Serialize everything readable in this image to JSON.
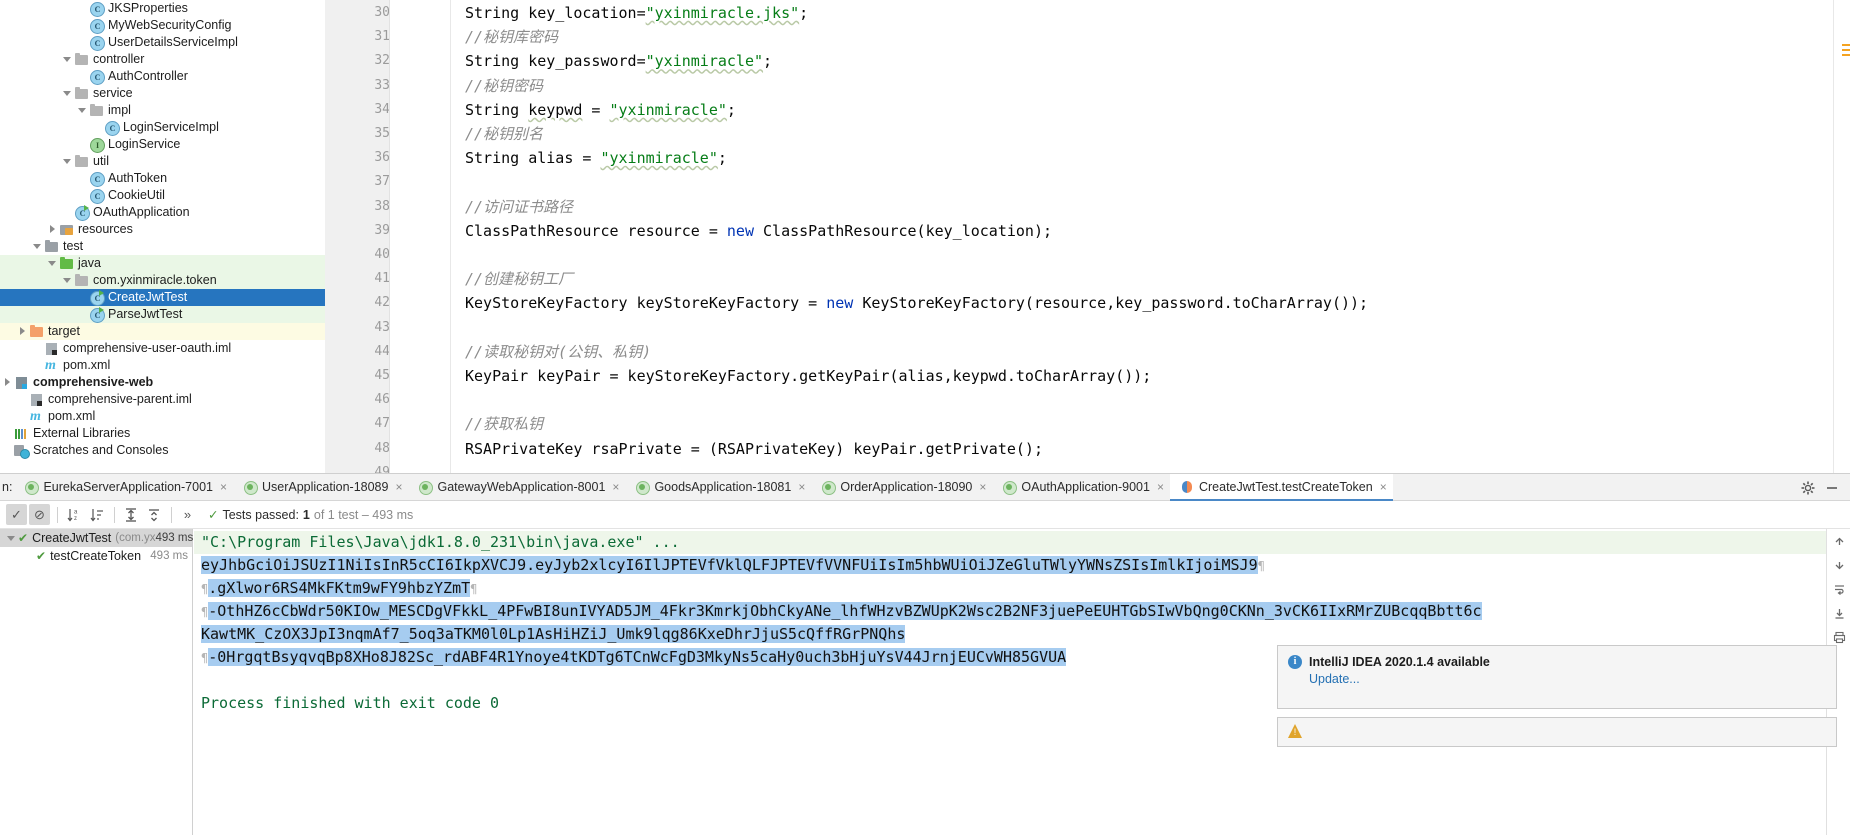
{
  "project_tree": [
    {
      "indent": 5,
      "arrow": "none",
      "icon": "cls",
      "label": "JKSProperties",
      "state": "normal"
    },
    {
      "indent": 5,
      "arrow": "none",
      "icon": "cls",
      "label": "MyWebSecurityConfig",
      "state": "normal"
    },
    {
      "indent": 5,
      "arrow": "none",
      "icon": "cls",
      "label": "UserDetailsServiceImpl",
      "state": "normal"
    },
    {
      "indent": 4,
      "arrow": "down",
      "icon": "pkg",
      "label": "controller",
      "state": "normal"
    },
    {
      "indent": 5,
      "arrow": "none",
      "icon": "cls",
      "label": "AuthController",
      "state": "normal"
    },
    {
      "indent": 4,
      "arrow": "down",
      "icon": "pkg",
      "label": "service",
      "state": "normal"
    },
    {
      "indent": 5,
      "arrow": "down",
      "icon": "pkg",
      "label": "impl",
      "state": "normal"
    },
    {
      "indent": 6,
      "arrow": "none",
      "icon": "cls",
      "label": "LoginServiceImpl",
      "state": "normal"
    },
    {
      "indent": 5,
      "arrow": "none",
      "icon": "iface",
      "label": "LoginService",
      "state": "normal"
    },
    {
      "indent": 4,
      "arrow": "down",
      "icon": "pkg",
      "label": "util",
      "state": "normal"
    },
    {
      "indent": 5,
      "arrow": "none",
      "icon": "cls",
      "label": "AuthToken",
      "state": "normal"
    },
    {
      "indent": 5,
      "arrow": "none",
      "icon": "cls",
      "label": "CookieUtil",
      "state": "normal"
    },
    {
      "indent": 4,
      "arrow": "none",
      "icon": "clsrun",
      "label": "OAuthApplication",
      "state": "normal"
    },
    {
      "indent": 3,
      "arrow": "right",
      "icon": "res",
      "label": "resources",
      "state": "normal"
    },
    {
      "indent": 2,
      "arrow": "down",
      "icon": "folder",
      "label": "test",
      "state": "normal"
    },
    {
      "indent": 3,
      "arrow": "down",
      "icon": "srcjava",
      "label": "java",
      "state": "tests"
    },
    {
      "indent": 4,
      "arrow": "down",
      "icon": "pkg",
      "label": "com.yxinmiracle.token",
      "state": "tests"
    },
    {
      "indent": 5,
      "arrow": "none",
      "icon": "clsrun",
      "label": "CreateJwtTest",
      "state": "selected"
    },
    {
      "indent": 5,
      "arrow": "none",
      "icon": "clsrun",
      "label": "ParseJwtTest",
      "state": "tests"
    },
    {
      "indent": 1,
      "arrow": "right",
      "icon": "target",
      "label": "target",
      "state": "target"
    },
    {
      "indent": 2,
      "arrow": "none",
      "icon": "module",
      "label": "comprehensive-user-oauth.iml",
      "state": "normal"
    },
    {
      "indent": 2,
      "arrow": "none",
      "icon": "maven",
      "label": "pom.xml",
      "state": "normal"
    },
    {
      "indent": 0,
      "arrow": "right",
      "icon": "modbold",
      "label": "comprehensive-web",
      "state": "bold"
    },
    {
      "indent": 1,
      "arrow": "none",
      "icon": "module",
      "label": "comprehensive-parent.iml",
      "state": "normal"
    },
    {
      "indent": 1,
      "arrow": "none",
      "icon": "maven",
      "label": "pom.xml",
      "state": "normal"
    },
    {
      "indent": 0,
      "arrow": "none",
      "icon": "extlib",
      "label": "External Libraries",
      "state": "normal"
    },
    {
      "indent": 0,
      "arrow": "none",
      "icon": "scratch",
      "label": "Scratches and Consoles",
      "state": "normal"
    }
  ],
  "editor": {
    "lines": [
      {
        "num": "30",
        "segments": [
          {
            "t": "String key_location=",
            "c": "plain"
          },
          {
            "t": "\"yxinmiracle.jks\"",
            "c": "str sq"
          },
          {
            "t": ";",
            "c": "plain"
          }
        ]
      },
      {
        "num": "31",
        "segments": [
          {
            "t": "//秘钥库密码",
            "c": "cmt"
          }
        ]
      },
      {
        "num": "32",
        "segments": [
          {
            "t": "String key_password=",
            "c": "plain"
          },
          {
            "t": "\"yxinmiracle\"",
            "c": "str sq"
          },
          {
            "t": ";",
            "c": "plain"
          }
        ]
      },
      {
        "num": "33",
        "segments": [
          {
            "t": "//秘钥密码",
            "c": "cmt"
          }
        ]
      },
      {
        "num": "34",
        "segments": [
          {
            "t": "String ",
            "c": "plain"
          },
          {
            "t": "keypwd",
            "c": "plain sq"
          },
          {
            "t": " = ",
            "c": "plain"
          },
          {
            "t": "\"yxinmiracle\"",
            "c": "str sq"
          },
          {
            "t": ";",
            "c": "plain"
          }
        ]
      },
      {
        "num": "35",
        "segments": [
          {
            "t": "//秘钥别名",
            "c": "cmt"
          }
        ]
      },
      {
        "num": "36",
        "segments": [
          {
            "t": "String alias = ",
            "c": "plain"
          },
          {
            "t": "\"yxinmiracle\"",
            "c": "str sq"
          },
          {
            "t": ";",
            "c": "plain"
          }
        ]
      },
      {
        "num": "37",
        "segments": []
      },
      {
        "num": "38",
        "segments": [
          {
            "t": "//访问证书路径",
            "c": "cmt"
          }
        ]
      },
      {
        "num": "39",
        "segments": [
          {
            "t": "ClassPathResource resource = ",
            "c": "plain"
          },
          {
            "t": "new",
            "c": "kw"
          },
          {
            "t": " ClassPathResource(key_location);",
            "c": "plain"
          }
        ]
      },
      {
        "num": "40",
        "segments": []
      },
      {
        "num": "41",
        "segments": [
          {
            "t": "//创建秘钥工厂",
            "c": "cmt"
          }
        ]
      },
      {
        "num": "42",
        "segments": [
          {
            "t": "KeyStoreKeyFactory keyStoreKeyFactory = ",
            "c": "plain"
          },
          {
            "t": "new",
            "c": "kw"
          },
          {
            "t": " KeyStoreKeyFactory(resource,key_password.toCharArray());",
            "c": "plain"
          }
        ]
      },
      {
        "num": "43",
        "segments": []
      },
      {
        "num": "44",
        "segments": [
          {
            "t": "//读取秘钥对(公钥、私钥)",
            "c": "cmt"
          }
        ]
      },
      {
        "num": "45",
        "segments": [
          {
            "t": "KeyPair keyPair = keyStoreKeyFactory.getKeyPair(alias,keypwd.toCharArray());",
            "c": "plain"
          }
        ]
      },
      {
        "num": "46",
        "segments": []
      },
      {
        "num": "47",
        "segments": [
          {
            "t": "//获取私钥",
            "c": "cmt"
          }
        ]
      },
      {
        "num": "48",
        "segments": [
          {
            "t": "RSAPrivateKey rsaPrivate = (RSAPrivateKey) keyPair.getPrivate();",
            "c": "plain"
          }
        ]
      },
      {
        "num": "49",
        "segments": []
      }
    ]
  },
  "run_tool_window": {
    "tabs_prefix_label": "n:",
    "tabs": [
      {
        "label": "EurekaServerApplication-7001",
        "icon": "spring-boot-icon",
        "active": false,
        "close": "×"
      },
      {
        "label": "UserApplication-18089",
        "icon": "spring-boot-icon",
        "active": false,
        "close": "×"
      },
      {
        "label": "GatewayWebApplication-8001",
        "icon": "spring-boot-icon",
        "active": false,
        "close": "×"
      },
      {
        "label": "GoodsApplication-18081",
        "icon": "spring-boot-icon",
        "active": false,
        "close": "×"
      },
      {
        "label": "OrderApplication-18090",
        "icon": "spring-boot-icon",
        "active": false,
        "close": "×"
      },
      {
        "label": "OAuthApplication-9001",
        "icon": "spring-boot-icon",
        "active": false,
        "close": "×"
      },
      {
        "label": "CreateJwtTest.testCreateToken",
        "icon": "junit-icon",
        "active": true,
        "close": "×"
      }
    ],
    "toolbar": {
      "show_passed_label": "✓",
      "hide_ignored_label": "⊘",
      "sort_alpha_label": "↓",
      "sort_duration_label": "↓",
      "expand_all_label": "⤓",
      "collapse_all_label": "⤒",
      "overflow_label": "»"
    },
    "status": {
      "check": "✓",
      "prefix": "Tests passed:",
      "count": "1",
      "suffix": "of 1 test – 493 ms"
    },
    "results": [
      {
        "indent": 0,
        "arrow": "down",
        "label": "CreateJwtTest",
        "package": "(com.yx",
        "time": "493 ms",
        "selected": true
      },
      {
        "indent": 1,
        "arrow": "none",
        "label": "testCreateToken",
        "package": "",
        "time": "493 ms",
        "selected": false
      }
    ],
    "console": [
      {
        "text": "\"C:\\Program Files\\Java\\jdk1.8.0_231\\bin\\java.exe\" ...",
        "style": "cmd"
      },
      {
        "text": "eyJhbGciOiJSUzI1NiIsInR5cCI6IkpXVCJ9.eyJyb2xlcyI6IlJPTEVfVklQLFJPTEVfVVNFUiIsIm5hbWUiOiJZeGluTWlyYWNsZSIsImlkIjoiMSJ9",
        "style": "jwt",
        "fold_right": true
      },
      {
        "text": ".gXlwor6RS4MkFKtm9wFY9hbzYZmT",
        "style": "jwt",
        "fold_left": true,
        "fold_right": true
      },
      {
        "text": "-OthHZ6cCbWdr50KIOw_MESCDgVFkkL_4PFwBI8unIVYAD5JM_4Fkr3KmrkjObhCkyANe_lhfWHzvBZWUpK2Wsc2B2NF3juePeEUHTGbSIwVbQng0CKNn_3vCK6IIxRMrZUBcqqBbtt6c",
        "style": "jwt",
        "fold_left": true
      },
      {
        "text": "KawtMK_CzOX3JpI3nqmAf7_5oq3aTKM0l0Lp1AsHiHZiJ_Umk9lqg86KxeDhrJjuS5cQffRGrPNQhs",
        "style": "jwt"
      },
      {
        "text": "-0HrgqtBsyqvqBp8XHo8J82Sc_rdABF4R1Ynoye4tKDTg6TCnWcFgD3MkyNs5caHy0uch3bHjuYsV44JrnjEUCvWH85GVUA",
        "style": "jwt",
        "fold_left": true
      },
      {
        "text": "",
        "style": "plain"
      },
      {
        "text": "Process finished with exit code 0",
        "style": "cmd-plain"
      }
    ]
  },
  "notifications": [
    {
      "type": "info",
      "title": "IntelliJ IDEA 2020.1.4 available",
      "link": "Update..."
    },
    {
      "type": "warning",
      "title": "",
      "link": ""
    }
  ],
  "colors": {
    "selection_blue": "#2675bf",
    "test_source_green": "#eaf7e6",
    "target_yellow": "#fdfbe3",
    "jwt_highlight": "#a6ccf0",
    "keyword_blue": "#0033b3",
    "string_green": "#067d17",
    "comment_gray": "#8c8c8c",
    "active_tab_underline": "#4a88c7"
  }
}
